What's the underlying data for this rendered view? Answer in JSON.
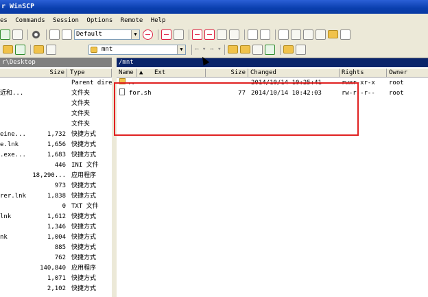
{
  "window": {
    "title": "r WinSCP"
  },
  "menu": [
    "es",
    "Commands",
    "Session",
    "Options",
    "Remote",
    "Help"
  ],
  "toolbar": {
    "transfer_profile": "Default"
  },
  "remote_nav": {
    "location": "mnt"
  },
  "left_pane": {
    "path": "r\\Desktop",
    "columns": [
      "Size",
      "Type"
    ],
    "rows": [
      {
        "name": "",
        "size": "",
        "type": "Parent dire"
      },
      {
        "name": "近和...",
        "size": "",
        "type": "文件夹"
      },
      {
        "name": "",
        "size": "",
        "type": "文件夹"
      },
      {
        "name": "",
        "size": "",
        "type": "文件夹"
      },
      {
        "name": "",
        "size": "",
        "type": "文件夹"
      },
      {
        "name": "eine...",
        "size": "1,732",
        "type": "快捷方式"
      },
      {
        "name": "e.lnk",
        "size": "1,656",
        "type": "快捷方式"
      },
      {
        "name": ".exe...",
        "size": "1,683",
        "type": "快捷方式"
      },
      {
        "name": "",
        "size": "446",
        "type": "INI 文件"
      },
      {
        "name": "",
        "size": "18,290...",
        "type": "应用程序"
      },
      {
        "name": "",
        "size": "973",
        "type": "快捷方式"
      },
      {
        "name": "rer.lnk",
        "size": "1,838",
        "type": "快捷方式"
      },
      {
        "name": "",
        "size": "0",
        "type": "TXT 文件"
      },
      {
        "name": "lnk",
        "size": "1,612",
        "type": "快捷方式"
      },
      {
        "name": "",
        "size": "1,346",
        "type": "快捷方式"
      },
      {
        "name": "nk",
        "size": "1,004",
        "type": "快捷方式"
      },
      {
        "name": "",
        "size": "885",
        "type": "快捷方式"
      },
      {
        "name": "",
        "size": "762",
        "type": "快捷方式"
      },
      {
        "name": "",
        "size": "140,840",
        "type": "应用程序"
      },
      {
        "name": "",
        "size": "1,071",
        "type": "快捷方式"
      },
      {
        "name": "",
        "size": "2,102",
        "type": "快捷方式"
      }
    ]
  },
  "right_pane": {
    "path": "/mnt",
    "columns": [
      "Name",
      "Ext",
      "Size",
      "Changed",
      "Rights",
      "Owner"
    ],
    "rows": [
      {
        "name": "..",
        "size": "",
        "changed": "2014/10/14 10:25:41",
        "rights": "rwxr-xr-x",
        "owner": "root"
      },
      {
        "name": "for.sh",
        "size": "77",
        "changed": "2014/10/14 10:42:03",
        "rights": "rw-r--r--",
        "owner": "root"
      }
    ]
  },
  "colors": {
    "highlight_box": "#e02020",
    "title_bar": "#0a3fae"
  }
}
